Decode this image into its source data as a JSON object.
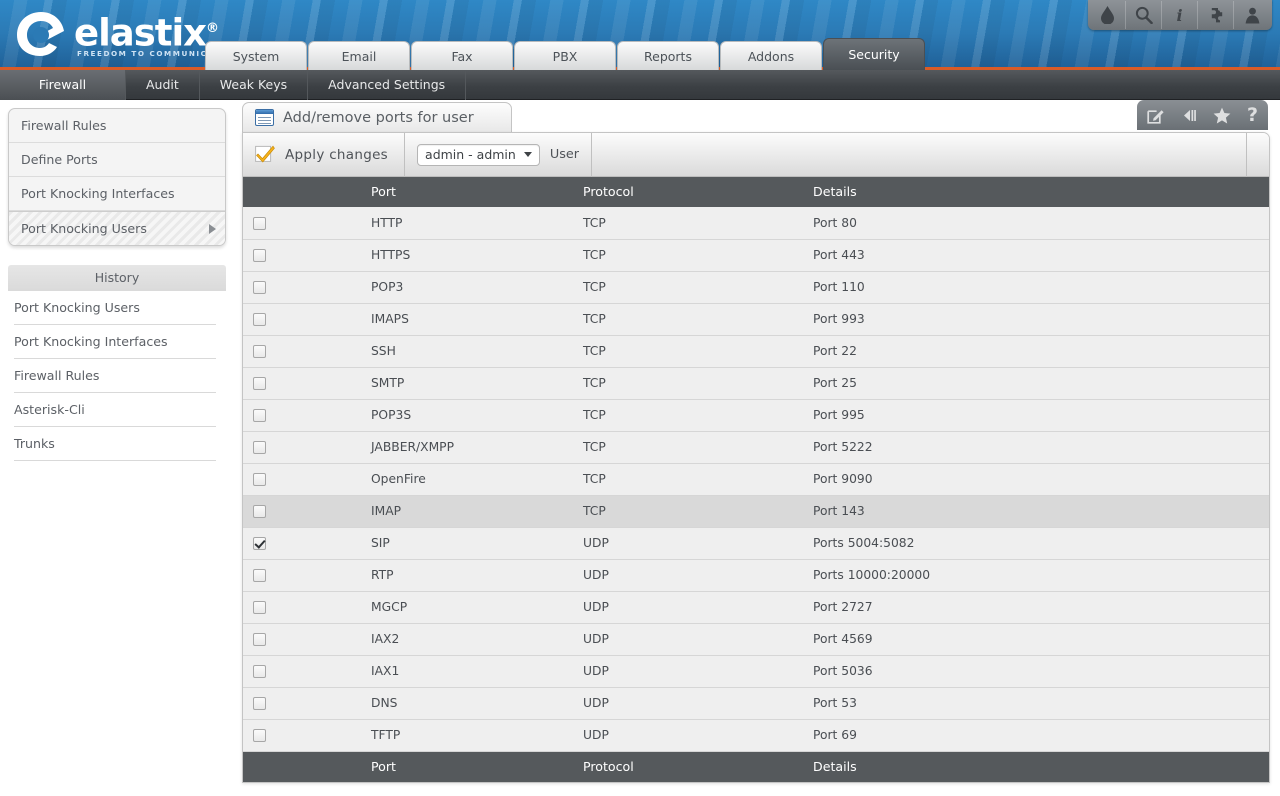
{
  "brand": {
    "name": "elastix",
    "registered": "®",
    "tagline": "FREEDOM TO COMMUNICATE"
  },
  "top_tools": [
    {
      "name": "theme-droplet-icon",
      "label": "Theme"
    },
    {
      "name": "search-icon",
      "label": "Search"
    },
    {
      "name": "info-icon",
      "label": "i"
    },
    {
      "name": "addons-puzzle-icon",
      "label": "Addons"
    },
    {
      "name": "user-icon",
      "label": "User"
    }
  ],
  "main_tabs": [
    {
      "label": "System",
      "active": false
    },
    {
      "label": "Email",
      "active": false
    },
    {
      "label": "Fax",
      "active": false
    },
    {
      "label": "PBX",
      "active": false
    },
    {
      "label": "Reports",
      "active": false
    },
    {
      "label": "Addons",
      "active": false
    },
    {
      "label": "Security",
      "active": true
    }
  ],
  "sub_nav": [
    {
      "label": "Firewall",
      "active": true
    },
    {
      "label": "Audit",
      "active": false
    },
    {
      "label": "Weak Keys",
      "active": false
    },
    {
      "label": "Advanced Settings",
      "active": false
    }
  ],
  "sidebar": {
    "menu": [
      {
        "label": "Firewall Rules",
        "selected": false
      },
      {
        "label": "Define Ports",
        "selected": false
      },
      {
        "label": "Port Knocking Interfaces",
        "selected": false
      },
      {
        "label": "Port Knocking Users",
        "selected": true
      }
    ],
    "history_title": "History",
    "history": [
      {
        "label": "Port Knocking Users"
      },
      {
        "label": "Port Knocking Interfaces"
      },
      {
        "label": "Firewall Rules"
      },
      {
        "label": "Asterisk-Cli"
      },
      {
        "label": "Trunks"
      }
    ]
  },
  "panel": {
    "title": "Add/remove ports for user",
    "tools": [
      {
        "name": "edit-icon"
      },
      {
        "name": "collapse-left-icon"
      },
      {
        "name": "star-icon"
      },
      {
        "name": "help-icon",
        "label": "?"
      }
    ]
  },
  "toolbar": {
    "apply_label": "Apply changes",
    "user_select_value": "admin - admin",
    "user_label": "User"
  },
  "table": {
    "columns": [
      "Port",
      "Protocol",
      "Details"
    ],
    "rows": [
      {
        "checked": false,
        "port": "HTTP",
        "protocol": "TCP",
        "details": "Port 80",
        "hover": false
      },
      {
        "checked": false,
        "port": "HTTPS",
        "protocol": "TCP",
        "details": "Port 443",
        "hover": false
      },
      {
        "checked": false,
        "port": "POP3",
        "protocol": "TCP",
        "details": "Port 110",
        "hover": false
      },
      {
        "checked": false,
        "port": "IMAPS",
        "protocol": "TCP",
        "details": "Port 993",
        "hover": false
      },
      {
        "checked": false,
        "port": "SSH",
        "protocol": "TCP",
        "details": "Port 22",
        "hover": false
      },
      {
        "checked": false,
        "port": "SMTP",
        "protocol": "TCP",
        "details": "Port 25",
        "hover": false
      },
      {
        "checked": false,
        "port": "POP3S",
        "protocol": "TCP",
        "details": "Port 995",
        "hover": false
      },
      {
        "checked": false,
        "port": "JABBER/XMPP",
        "protocol": "TCP",
        "details": "Port 5222",
        "hover": false
      },
      {
        "checked": false,
        "port": "OpenFire",
        "protocol": "TCP",
        "details": "Port 9090",
        "hover": false
      },
      {
        "checked": false,
        "port": "IMAP",
        "protocol": "TCP",
        "details": "Port 143",
        "hover": true
      },
      {
        "checked": true,
        "port": "SIP",
        "protocol": "UDP",
        "details": "Ports 5004:5082",
        "hover": false
      },
      {
        "checked": false,
        "port": "RTP",
        "protocol": "UDP",
        "details": "Ports 10000:20000",
        "hover": false
      },
      {
        "checked": false,
        "port": "MGCP",
        "protocol": "UDP",
        "details": "Port 2727",
        "hover": false
      },
      {
        "checked": false,
        "port": "IAX2",
        "protocol": "UDP",
        "details": "Port 4569",
        "hover": false
      },
      {
        "checked": false,
        "port": "IAX1",
        "protocol": "UDP",
        "details": "Port 5036",
        "hover": false
      },
      {
        "checked": false,
        "port": "DNS",
        "protocol": "UDP",
        "details": "Port 53",
        "hover": false
      },
      {
        "checked": false,
        "port": "TFTP",
        "protocol": "UDP",
        "details": "Port 69",
        "hover": false
      }
    ]
  },
  "colors": {
    "header_blue": "#2b7ab5",
    "accent_orange": "#d95b27",
    "table_header": "#55595c",
    "row_bg": "#efefef"
  }
}
